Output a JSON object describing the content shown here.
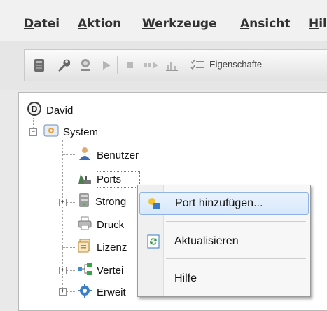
{
  "menubar": {
    "items": [
      "Datei",
      "Aktion",
      "Werkzeuge",
      "Ansicht",
      "Hil"
    ],
    "underline": [
      "D",
      "A",
      "W",
      "A",
      "H"
    ]
  },
  "toolbar": {
    "buttons": [
      {
        "name": "console-icon"
      },
      {
        "name": "wrench-icon"
      },
      {
        "name": "user-connect-icon"
      },
      {
        "name": "play-icon"
      },
      {
        "name": "stop-icon"
      },
      {
        "name": "step-icon"
      },
      {
        "name": "chart-icon"
      },
      {
        "name": "properties-icon"
      }
    ],
    "properties_label": "Eigenschafte"
  },
  "tree": {
    "root": "David",
    "system": "System",
    "benutzer": "Benutzer",
    "ports": "Ports",
    "strong": "Strong",
    "druck": "Druck",
    "lizenz": "Lizenz",
    "verteil": "Vertei",
    "erweit": "Erweit"
  },
  "context_menu": {
    "add_port": "Port hinzufügen...",
    "refresh": "Aktualisieren",
    "help": "Hilfe"
  },
  "colors": {
    "highlight_border": "#8fb3e6",
    "highlight_fill": "#d7e8fb"
  }
}
